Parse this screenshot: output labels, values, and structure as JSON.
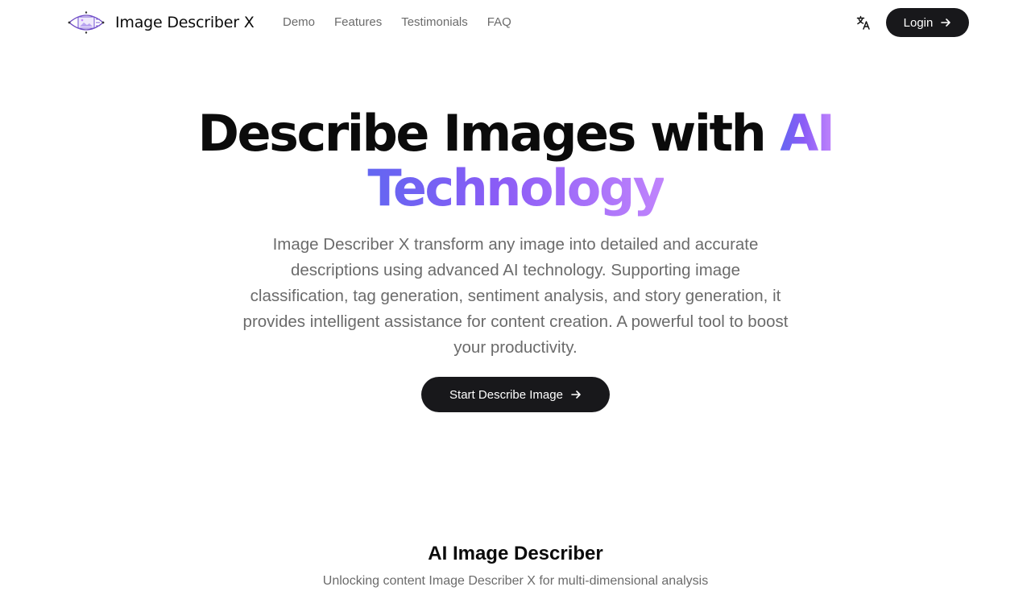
{
  "header": {
    "brand_name": "Image Describer X",
    "nav": [
      {
        "label": "Demo"
      },
      {
        "label": "Features"
      },
      {
        "label": "Testimonials"
      },
      {
        "label": "FAQ"
      }
    ],
    "translate_icon": "translate-icon",
    "login_label": "Login"
  },
  "hero": {
    "title_plain": "Describe Images with ",
    "title_accent_1": "AI",
    "title_accent_2": "Technology",
    "description": "Image Describer X transform any image into detailed and accurate descriptions using advanced AI technology. Supporting image classification, tag generation, sentiment analysis, and story generation, it provides intelligent assistance for content creation. A powerful tool to boost your productivity.",
    "cta_label": "Start Describe Image"
  },
  "section": {
    "title": "AI Image Describer",
    "subtitle": "Unlocking content Image Describer X for multi-dimensional analysis"
  },
  "colors": {
    "accent_start": "#6366f1",
    "accent_end": "#c084fc",
    "button_bg": "#18181b",
    "muted_text": "#6b6b6b"
  }
}
